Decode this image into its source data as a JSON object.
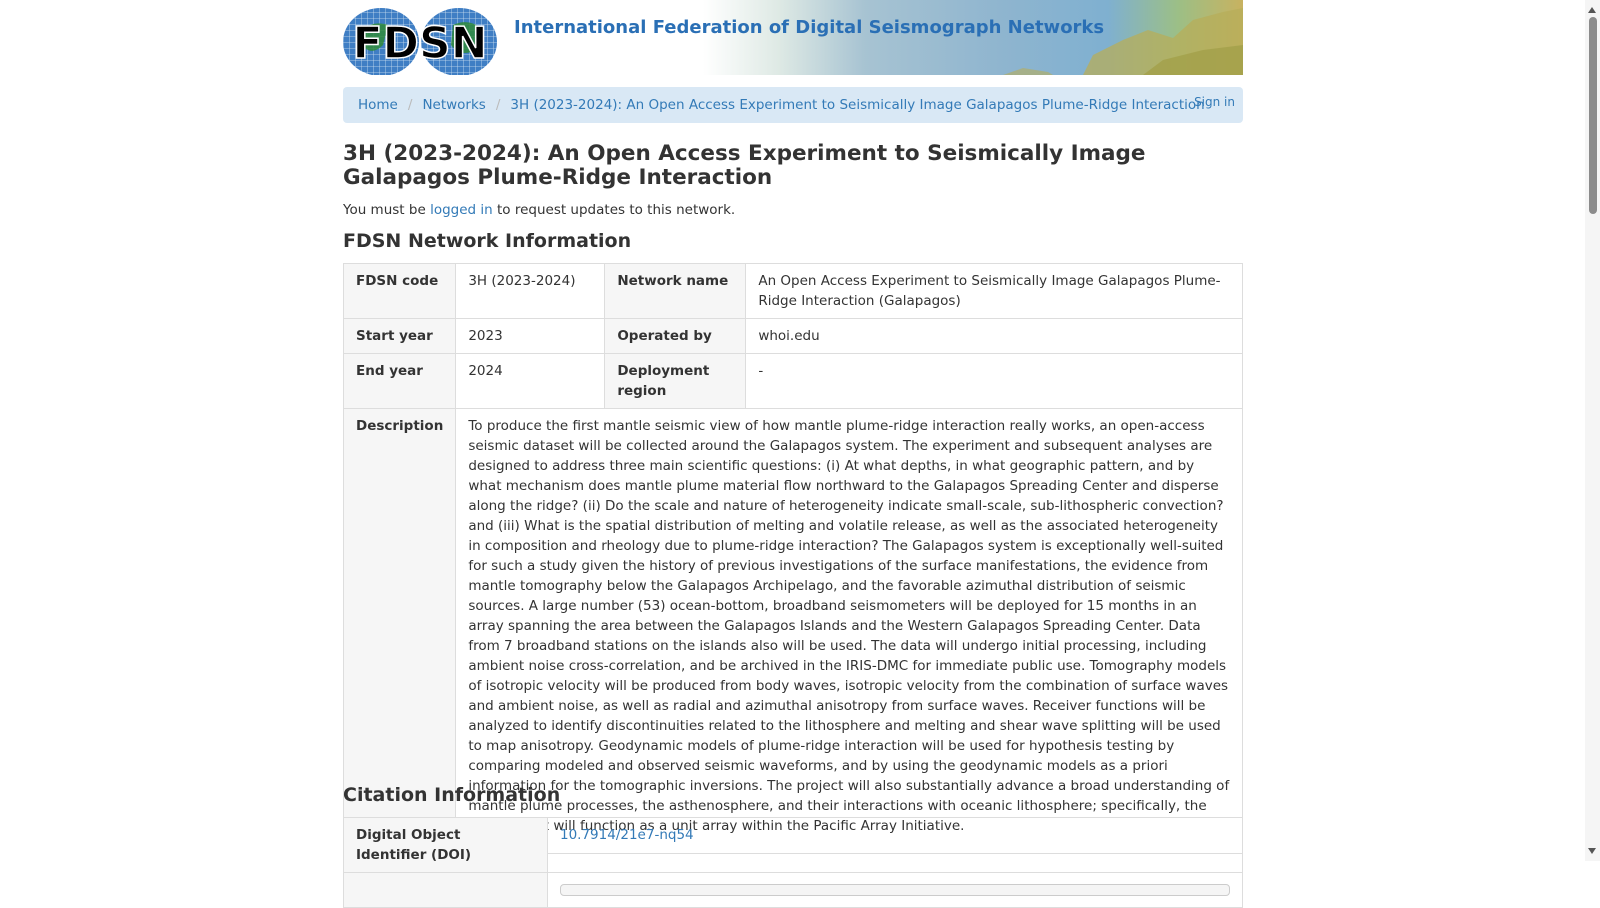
{
  "header": {
    "logo_text": "FDSN",
    "site_title": "International Federation of Digital Seismograph Networks"
  },
  "breadcrumb": {
    "home": "Home",
    "networks": "Networks",
    "current": "3H (2023-2024): An Open Access Experiment to Seismically Image Galapagos Plume-Ridge Interaction",
    "sign_in": "Sign in"
  },
  "page": {
    "title": "3H (2023-2024): An Open Access Experiment to Seismically Image Galapagos Plume-Ridge Interaction",
    "notice_prefix": "You must be ",
    "notice_link": "logged in",
    "notice_suffix": " to request updates to this network."
  },
  "network_info": {
    "heading": "FDSN Network Information",
    "fdsn_code_label": "FDSN code",
    "fdsn_code": "3H (2023-2024)",
    "network_name_label": "Network name",
    "network_name": "An Open Access Experiment to Seismically Image Galapagos Plume-Ridge Interaction (Galapagos)",
    "start_year_label": "Start year",
    "start_year": "2023",
    "operated_by_label": "Operated by",
    "operated_by": "whoi.edu",
    "end_year_label": "End year",
    "end_year": "2024",
    "deployment_region_label": "Deployment region",
    "deployment_region": "-",
    "description_label": "Description",
    "description": "To produce the first mantle seismic view of how mantle plume-ridge interaction really works, an open-access seismic dataset will be collected around the Galapagos system. The experiment and subsequent analyses are designed to address three main scientific questions: (i) At what depths, in what geographic pattern, and by what mechanism does mantle plume material flow northward to the Galapagos Spreading Center and disperse along the ridge? (ii) Do the scale and nature of heterogeneity indicate small-scale, sub-lithospheric convection? and (iii) What is the spatial distribution of melting and volatile release, as well as the associated heterogeneity in composition and rheology due to plume-ridge interaction? The Galapagos system is exceptionally well-suited for such a study given the history of previous investigations of the surface manifestations, the evidence from mantle tomography below the Galapagos Archipelago, and the favorable azimuthal distribution of seismic sources. A large number (53) ocean-bottom, broadband seismometers will be deployed for 15 months in an array spanning the area between the Galapagos Islands and the Western Galapagos Spreading Center. Data from 7 broadband stations on the islands also will be used. The data will undergo initial processing, including ambient noise cross-correlation, and be archived in the IRIS-DMC for immediate public use. Tomography models of isotropic velocity will be produced from body waves, isotropic velocity from the combination of surface waves and ambient noise, as well as radial and azimuthal anisotropy from surface waves. Receiver functions will be analyzed to identify discontinuities related to the lithosphere and melting and shear wave splitting will be used to map anisotropy. Geodynamic models of plume-ridge interaction will be used for hypothesis testing by comparing modeled and observed seismic waveforms, and by using the geodynamic models as a priori information for the tomographic inversions. The project will also substantially advance a broad understanding of mantle plume processes, the asthenosphere, and their interactions with oceanic lithosphere; specifically, the deployment will function as a unit array within the Pacific Array Initiative."
  },
  "citation_info": {
    "heading": "Citation Information",
    "doi_label": "Digital Object Identifier (DOI)",
    "doi": "10.7914/21e7-nq54"
  },
  "colors": {
    "link": "#337ab7",
    "breadcrumb_bg": "#d9e8f5",
    "title_blue": "#2a6fb5"
  }
}
